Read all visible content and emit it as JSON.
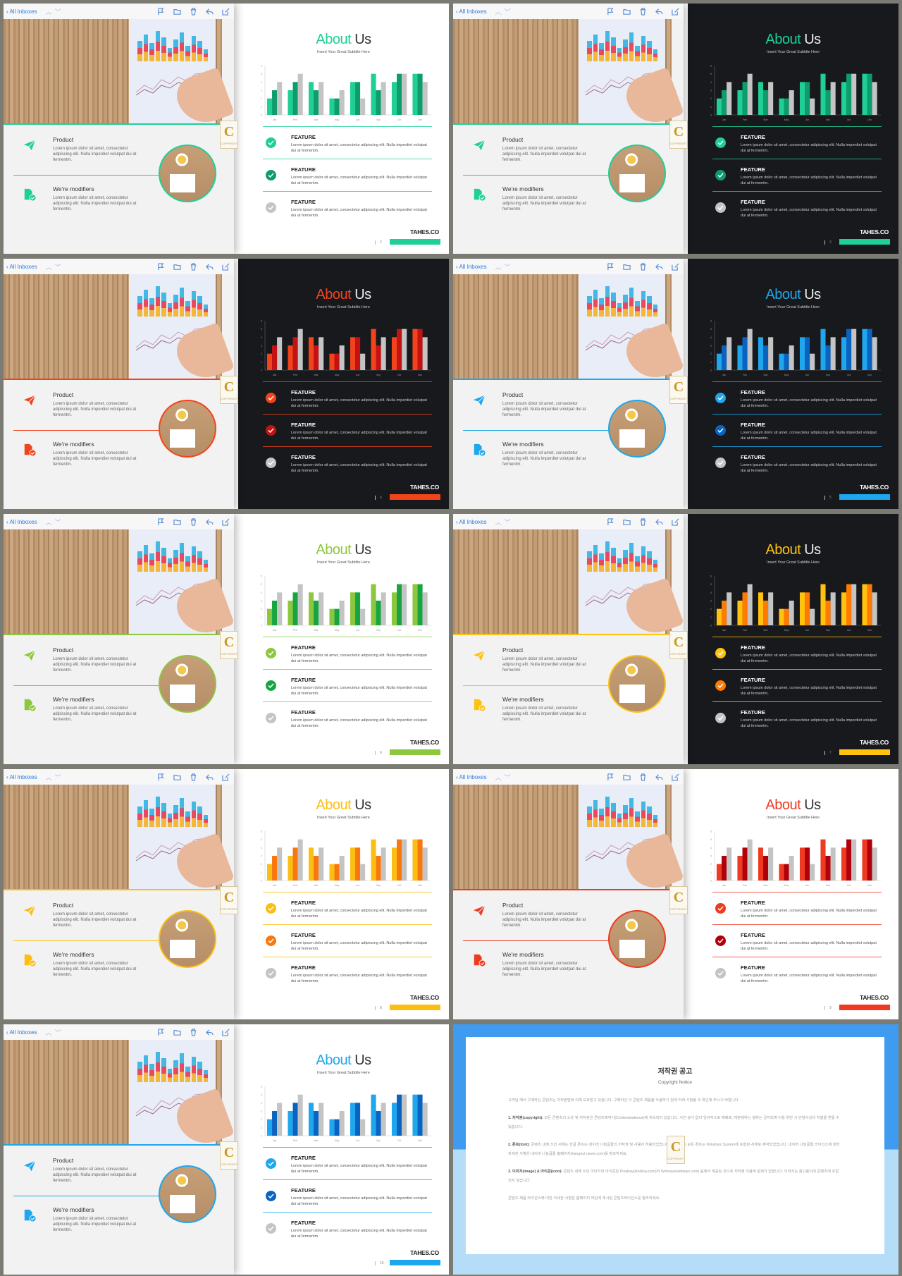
{
  "toolbar": {
    "back_label": "All Inboxes",
    "icons": [
      "chevron-up-icon",
      "chevron-down-icon",
      "flag-icon",
      "folder-icon",
      "trash-icon",
      "reply-icon",
      "compose-icon"
    ]
  },
  "content": {
    "title_accent": "About",
    "title_rest": "Us",
    "subtitle": "Insert Your Great Subtitle Here",
    "product_title": "Product",
    "product_text": "Lorem ipsum dolor sit amet, consectetur adipiscing elit. Nulla imperdiet volutpat dui at fermentm.",
    "modifiers_title": "We're modifiers",
    "modifiers_text": "Lorem ipsum dolor sit amet, consectetur adipiscing elit. Nulla imperdiet volutpat dui at fermentm.",
    "feature_title": "FEATURE",
    "feature_text": "Lorem ipsum dolor sit amet, consectetur adipiscing elit. Nulla imperdiet volutpat dui at fermentm.",
    "brand": "TAHES.CO",
    "logo_letter": "C",
    "logo_text": "COPYRIGHT"
  },
  "chart_data": {
    "type": "bar",
    "categories": [
      "Jan",
      "Feb",
      "Mar",
      "May",
      "Jun",
      "Sep",
      "Oct",
      "Dec"
    ],
    "series": [
      {
        "values": [
          2,
          3,
          4,
          2,
          4,
          5,
          4,
          5
        ]
      },
      {
        "values": [
          3,
          4,
          3,
          2,
          4,
          3,
          5,
          5
        ]
      },
      {
        "values": [
          4,
          5,
          4,
          3,
          2,
          4,
          5,
          4
        ]
      }
    ],
    "ylim": [
      0,
      6
    ],
    "yticks": [
      0,
      1,
      2,
      3,
      4,
      5,
      6
    ],
    "grid": false
  },
  "slides": [
    {
      "page": "2",
      "primary": "#1fcf95",
      "secondary": "#0e9c6c",
      "dark": false
    },
    {
      "page": "3",
      "primary": "#1fcf95",
      "secondary": "#0e9c6c",
      "dark": true
    },
    {
      "page": "4",
      "primary": "#f2441c",
      "secondary": "#c41212",
      "dark": true
    },
    {
      "page": "5",
      "primary": "#1ea7ec",
      "secondary": "#0b63c1",
      "dark": true
    },
    {
      "page": "6",
      "primary": "#8dc63f",
      "secondary": "#16a540",
      "dark": false
    },
    {
      "page": "7",
      "primary": "#ffc20e",
      "secondary": "#ff7a00",
      "dark": true
    },
    {
      "page": "8",
      "primary": "#fbbf14",
      "secondary": "#f8770f",
      "dark": false
    },
    {
      "page": "9",
      "primary": "#ef3a22",
      "secondary": "#b0000a",
      "dark": false
    },
    {
      "page": "10",
      "primary": "#1ea7ec",
      "secondary": "#0b63c1",
      "dark": false
    }
  ],
  "third_color": "#c4c4c4",
  "copyright": {
    "title": "저작권 공고",
    "subtitle": "Copyright Notice",
    "intro": "고객님 께서 구매하신 콘텐츠는 저작권법에 의해 보호받고 있습니다. 구매하신 이 콘텐츠 제품을 사용하기 전에 아래 사항을 꼭 확인해 주시기 바랍니다.",
    "p1_head": "1. 저작권(copyright):",
    "p1": "모든 콘텐츠의 소유 및 저작권은 콘텐츠제작사(Contentstakeout)에 귀속되어 있습니다. 사전 승낙 없이 임의적으로 재배포, 재판매하는 행위는 금지되며 이를 위반 시 민형사상의 처벌을 받을 수 있습니다.",
    "p2_head": "2. 폰트(font):",
    "p2": "콘텐츠 내에 쓰인 서체는 한글 폰트는 네이버 나눔글꼴의 저작권 및 사용이 허용되었습니다. 한글 외의 모든 폰트는 Windows System에 포함된 서체로 제작되었습니다. 네이버 나눔글꼴 라이선스에 대한 자세한 사항은 네이버 나눔글꼴 홈페이지(hangeul.naver.com)를 참조하세요.",
    "p3_head": "3. 이미지(image) & 아이콘(icon):",
    "p3": "콘텐츠 내에 쓰인 이미지와 아이콘은 Pixabay(pixabay.com)와 Webalys(webalys.com) 등에서 제공된 것으로 저작권 이용에 문제가 없습니다. 이미지는 참고용이며 콘텐츠에 포함되지 않습니다.",
    "outro": "콘텐츠 제품 라이선스에 대한 자세한 사항은 홈페이지 하단에 게시된 콘텐츠라이선스를 참조하세요.",
    "bg_top": "#3f9bf0",
    "bg_bottom": "#b6ddf8"
  }
}
